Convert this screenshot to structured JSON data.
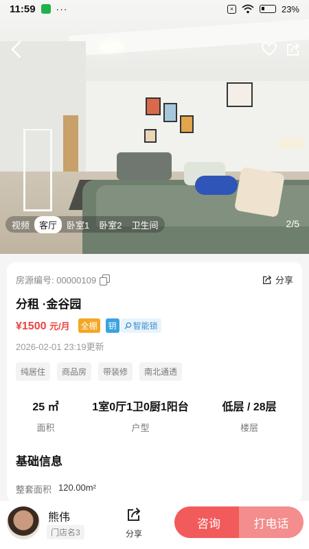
{
  "status_bar": {
    "time": "11:59",
    "dots": "···",
    "battery": "23%"
  },
  "photo": {
    "tabs": [
      "视频",
      "客厅",
      "卧室1",
      "卧室2",
      "卫生间"
    ],
    "active_tab": "客厅",
    "counter": "2/5"
  },
  "listing": {
    "id_label": "房源编号: 00000109",
    "share_label": "分享",
    "title": "分租 ·金谷园",
    "price": "¥1500",
    "price_unit": "元/月",
    "badge_full": "全棚",
    "badge_key": "钥",
    "badge_lock": "智能锁",
    "updated": "2026-02-01 23:19更新",
    "tags": [
      "纯居住",
      "商品房",
      "带装修",
      "南北通透"
    ],
    "stats": [
      {
        "value": "25 ㎡",
        "label": "面积"
      },
      {
        "value": "1室0厅1卫0厨1阳台",
        "label": "户型"
      },
      {
        "value": "低层 / 28层",
        "label": "楼层"
      }
    ],
    "section_title": "基础信息",
    "area_label": "整套面积",
    "area_value": "120.00m²"
  },
  "bottom_bar": {
    "agent_name": "熊伟",
    "store": "门店名3",
    "share_label": "分享",
    "consult_label": "咨询",
    "call_label": "打电话"
  },
  "colors": {
    "accent": "#f25b5b",
    "accent_light": "#f48d8d",
    "price": "#e8443f",
    "badge_full": "#f5a623",
    "badge_key": "#3aa3e0"
  },
  "icons": [
    "back-icon",
    "heart-icon",
    "share-icon",
    "copy-icon",
    "lock-search-icon",
    "wifi-icon",
    "battery-icon"
  ]
}
